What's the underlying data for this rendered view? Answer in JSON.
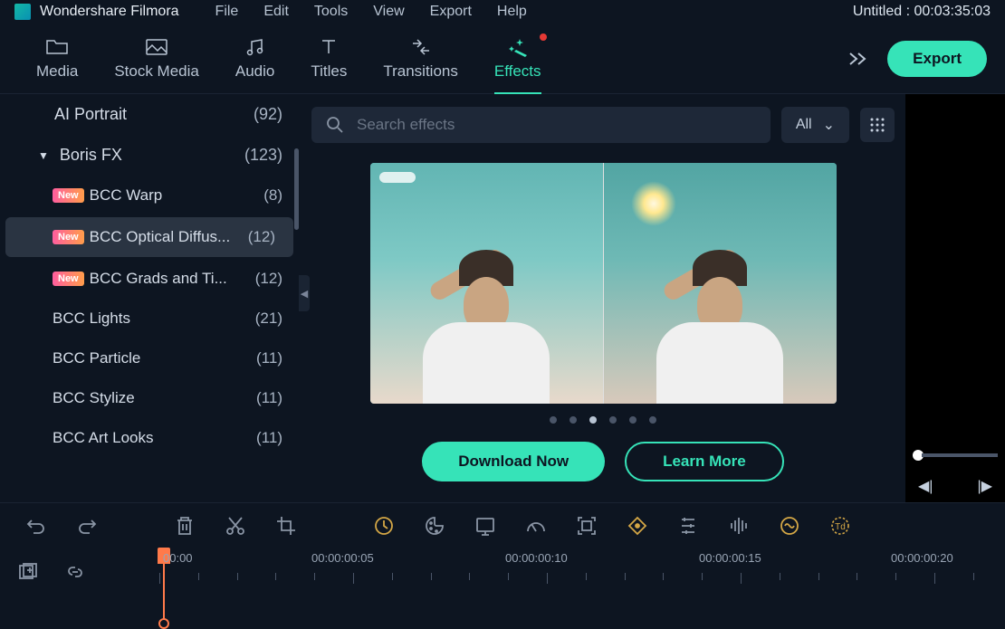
{
  "titlebar": {
    "app_name": "Wondershare Filmora",
    "menus": [
      "File",
      "Edit",
      "Tools",
      "View",
      "Export",
      "Help"
    ],
    "project_status": "Untitled : 00:03:35:03"
  },
  "toolbar": {
    "tabs": [
      {
        "label": "Media"
      },
      {
        "label": "Stock Media"
      },
      {
        "label": "Audio"
      },
      {
        "label": "Titles"
      },
      {
        "label": "Transitions"
      },
      {
        "label": "Effects",
        "active": true,
        "dot": true
      }
    ],
    "export_label": "Export"
  },
  "sidebar": {
    "items": [
      {
        "label": "AI Portrait",
        "count": "(92)",
        "type": "top"
      },
      {
        "label": "Boris FX",
        "count": "(123)",
        "type": "collapsible",
        "expanded": true
      },
      {
        "label": "BCC Warp",
        "count": "(8)",
        "type": "child",
        "new": true
      },
      {
        "label": "BCC Optical Diffus...",
        "count": "(12)",
        "type": "child",
        "new": true,
        "selected": true
      },
      {
        "label": "BCC Grads and Ti...",
        "count": "(12)",
        "type": "child",
        "new": true
      },
      {
        "label": "BCC Lights",
        "count": "(21)",
        "type": "child"
      },
      {
        "label": "BCC Particle",
        "count": "(11)",
        "type": "child"
      },
      {
        "label": "BCC Stylize",
        "count": "(11)",
        "type": "child"
      },
      {
        "label": "BCC Art Looks",
        "count": "(11)",
        "type": "child"
      }
    ]
  },
  "content": {
    "search_placeholder": "Search effects",
    "filter_label": "All",
    "cta_primary": "Download Now",
    "cta_secondary": "Learn More",
    "new_badge": "New"
  },
  "timeline": {
    "times": [
      "00:00",
      "00:00:00:05",
      "00:00:00:10",
      "00:00:00:15",
      "00:00:00:20"
    ]
  }
}
